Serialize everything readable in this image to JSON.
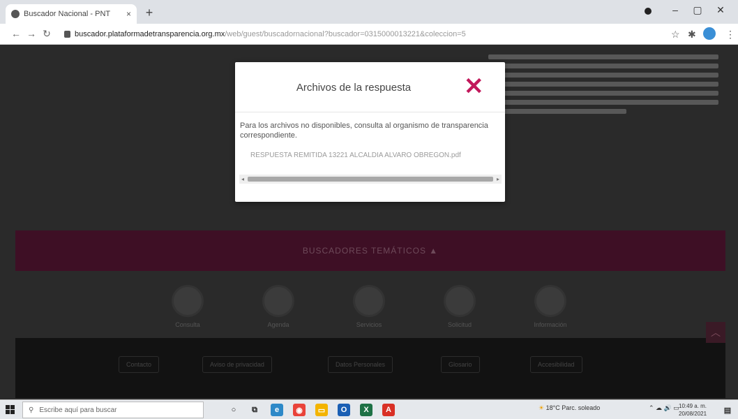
{
  "browser": {
    "tab_title": "Buscador Nacional - PNT",
    "tab_close": "×",
    "new_tab": "+",
    "url_host": "buscador.plataformadetransparencia.org.mx",
    "url_path": "/web/guest/buscadornacional?buscador=0315000013221&coleccion=5",
    "window_controls": [
      "–",
      "▢",
      "✕"
    ]
  },
  "modal": {
    "title": "Archivos de la respuesta",
    "close_label": "✕",
    "message": "Para los archivos no disponibles, consulta al organismo de transparencia correspondiente.",
    "file_link": "RESPUESTA REMITIDA 13221 ALCALDIA ALVARO OBREGON.pdf",
    "accent_color": "#c2185b"
  },
  "page": {
    "bar_label": "BUSCADORES TEMÁTICOS ▲",
    "circle_labels": [
      "Consulta",
      "Agenda",
      "Servicios",
      "Solicitud",
      "Información"
    ],
    "footer_links": [
      "Contacto",
      "Aviso de privacidad",
      "Datos Personales",
      "Glosario",
      "Accesibilidad"
    ]
  },
  "taskbar": {
    "search_placeholder": "Escribe aquí para buscar",
    "weather": "18°C  Parc. soleado",
    "time": "10:49 a. m.",
    "date": "20/08/2021"
  }
}
